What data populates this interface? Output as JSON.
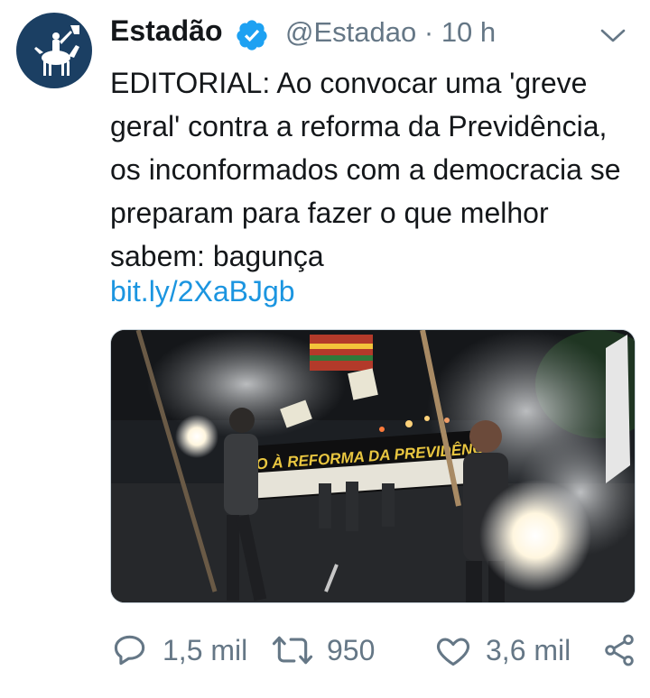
{
  "tweet": {
    "author_name": "Estadão",
    "handle": "@Estadao",
    "separator": "·",
    "time": "10 h",
    "text": "EDITORIAL: Ao convocar uma 'greve geral' contra a reforma da Previdência, os inconformados com a democracia se preparam para fazer o que melhor sabem: bagunça",
    "link": "bit.ly/2XaBJgb",
    "image_banner_text": "O À REFORMA DA PREVIDÊNC"
  },
  "actions": {
    "replies": "1,5 mil",
    "retweets": "950",
    "likes": "3,6 mil"
  },
  "colors": {
    "link": "#1b95e0",
    "verified": "#1da1f2",
    "muted": "#657786",
    "avatar_bg": "#1b3f63"
  },
  "icons": [
    "verified-badge-icon",
    "chevron-down-icon",
    "reply-icon",
    "retweet-icon",
    "like-icon",
    "share-icon"
  ]
}
